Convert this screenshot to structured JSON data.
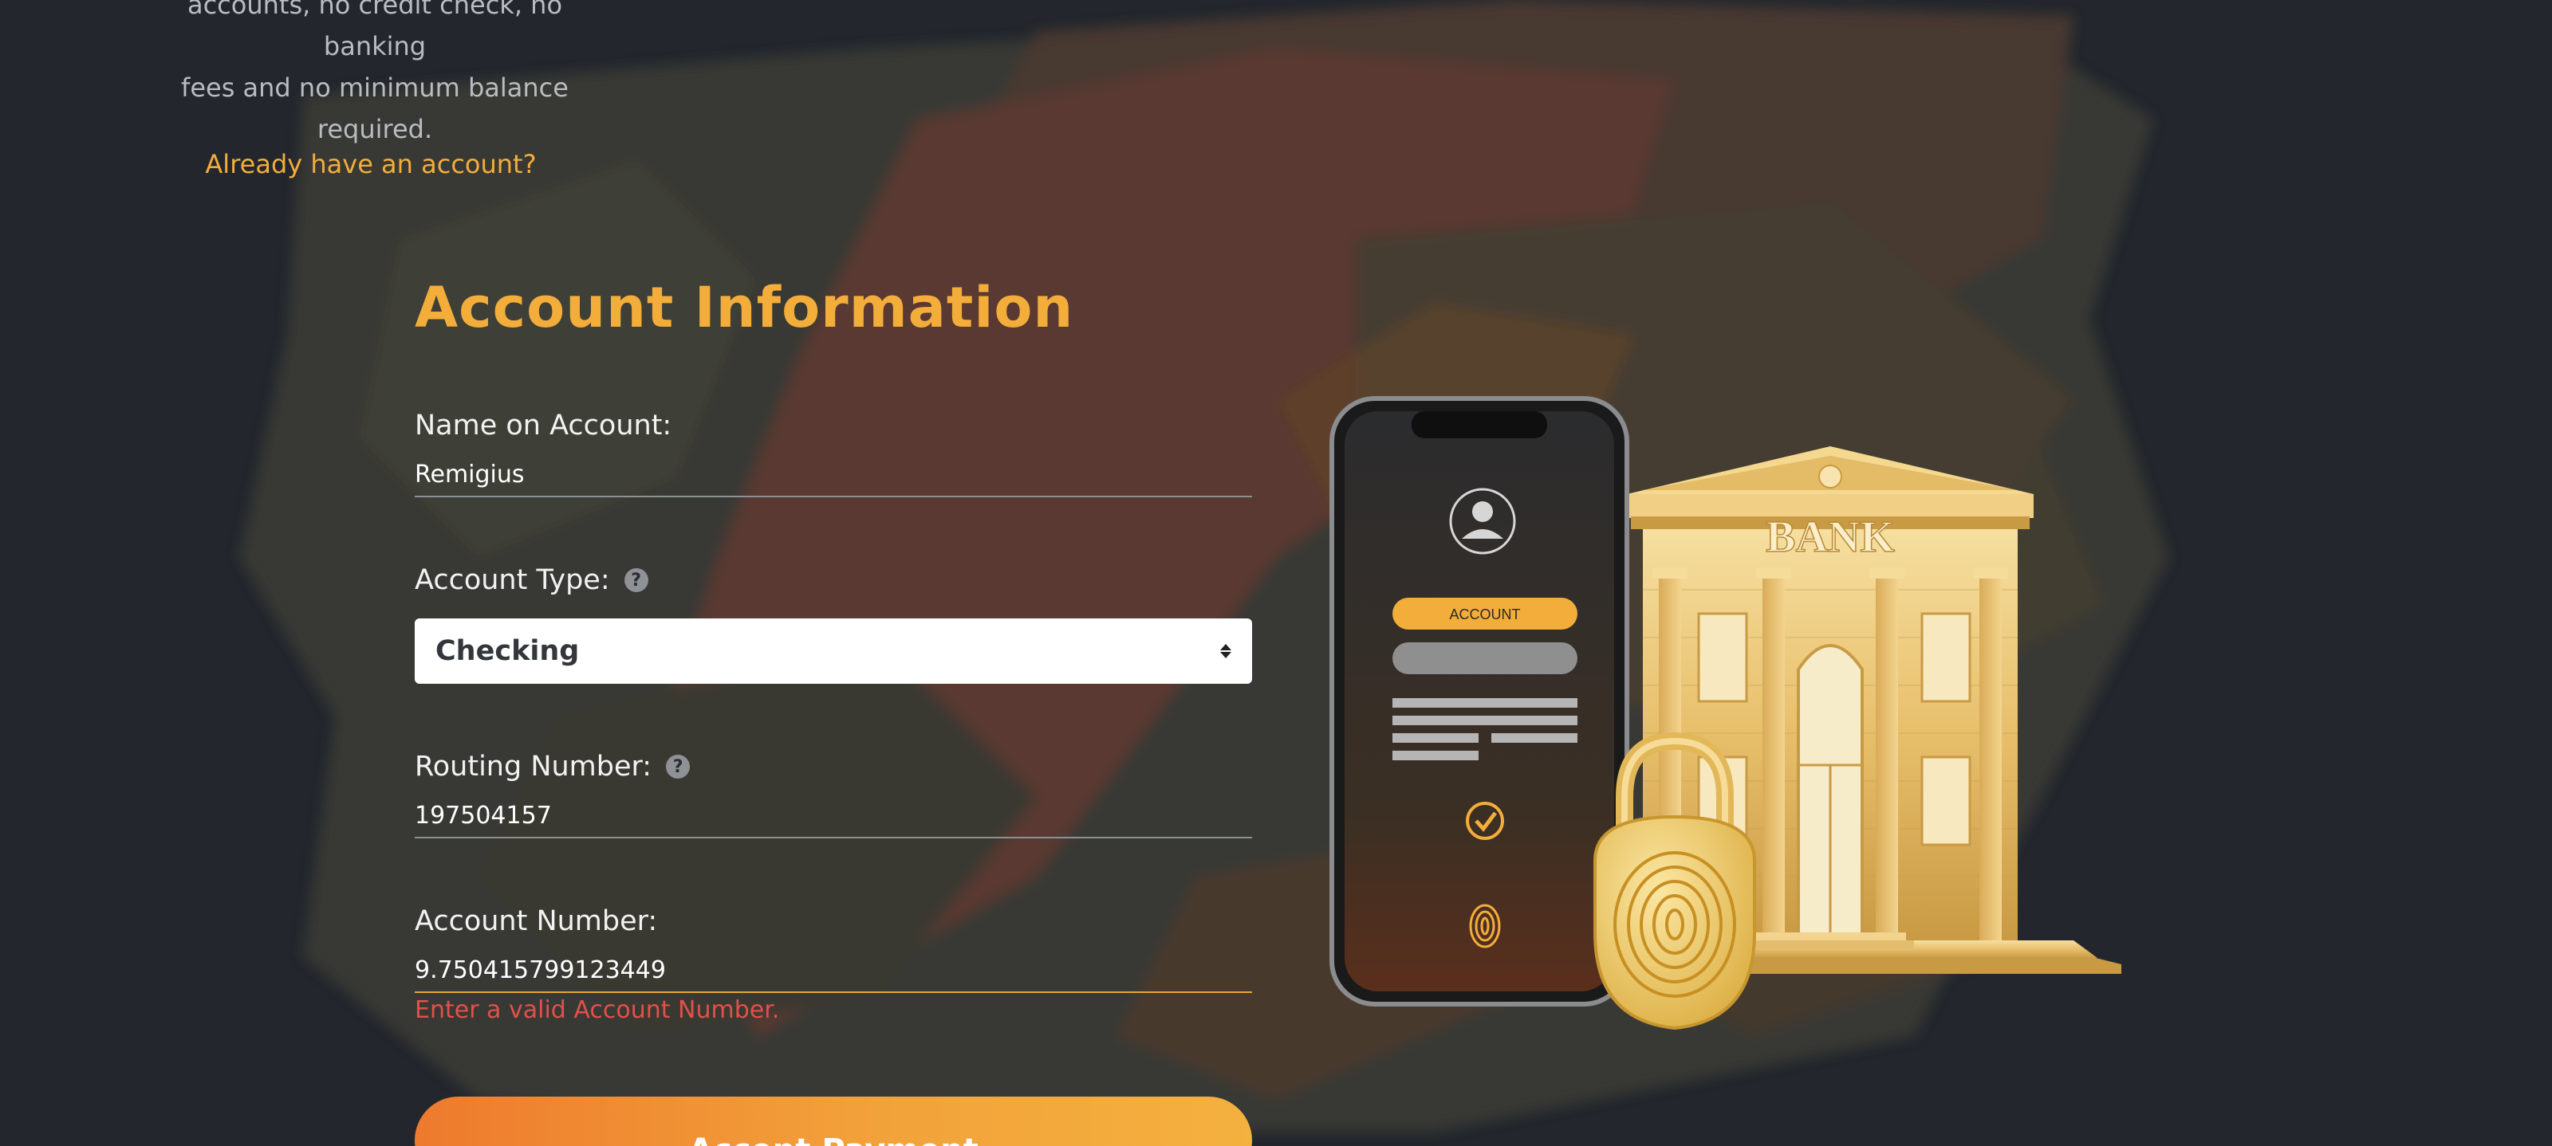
{
  "intro": {
    "lines": [
      "accounts, no credit check, no banking",
      "fees and no minimum balance",
      "required."
    ]
  },
  "login_link": "Already have an account?",
  "form": {
    "title": "Account Information",
    "name_label": "Name on Account:",
    "name_value": "Remigius",
    "type_label": "Account Type:",
    "type_value": "Checking",
    "routing_label": "Routing Number:",
    "routing_value": "197504157",
    "account_label": "Account Number:",
    "account_value": "9.750415799123449",
    "account_error": "Enter a valid Account Number.",
    "help_glyph": "?",
    "submit_label": "Accept Payment"
  },
  "illustration": {
    "phone_button_label": "ACCOUNT",
    "bank_sign": "BANK",
    "icons": [
      "user-avatar-icon",
      "check-circle-icon",
      "fingerprint-icon",
      "padlock-icon",
      "bank-building-icon"
    ]
  },
  "colors": {
    "accent": "#f3ad3b",
    "error": "#e2504a",
    "background": "#23272d"
  }
}
